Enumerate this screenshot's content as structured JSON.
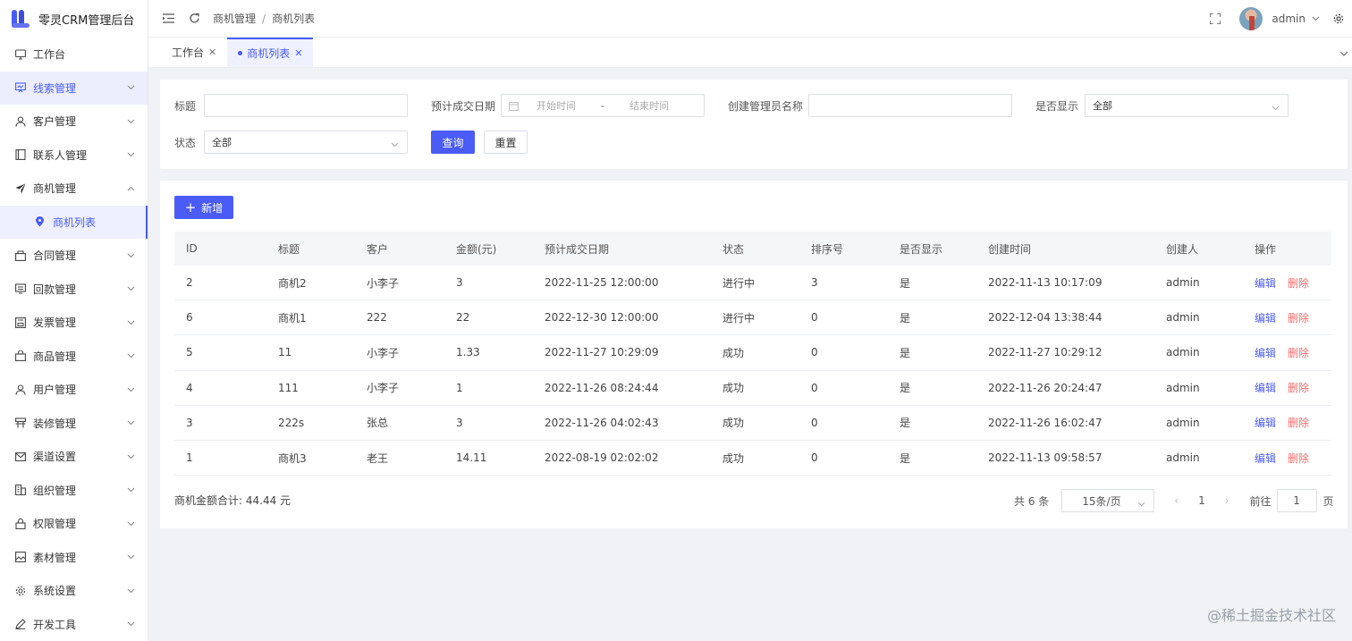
{
  "app": {
    "title": "零灵CRM管理后台"
  },
  "sidebar": {
    "items": [
      {
        "label": "工作台",
        "icon": "monitor-icon"
      },
      {
        "label": "线索管理",
        "icon": "clue-icon"
      },
      {
        "label": "客户管理",
        "icon": "user-icon"
      },
      {
        "label": "联系人管理",
        "icon": "contacts-icon"
      },
      {
        "label": "商机管理",
        "icon": "send-icon"
      },
      {
        "label": "商机列表",
        "icon": "location-icon"
      },
      {
        "label": "合同管理",
        "icon": "contract-icon"
      },
      {
        "label": "回款管理",
        "icon": "payment-icon"
      },
      {
        "label": "发票管理",
        "icon": "invoice-icon"
      },
      {
        "label": "商品管理",
        "icon": "product-icon"
      },
      {
        "label": "用户管理",
        "icon": "user-icon"
      },
      {
        "label": "装修管理",
        "icon": "decor-icon"
      },
      {
        "label": "渠道设置",
        "icon": "mail-icon"
      },
      {
        "label": "组织管理",
        "icon": "org-icon"
      },
      {
        "label": "权限管理",
        "icon": "lock-icon"
      },
      {
        "label": "素材管理",
        "icon": "image-icon"
      },
      {
        "label": "系统设置",
        "icon": "gear-icon"
      },
      {
        "label": "开发工具",
        "icon": "pen-icon"
      }
    ]
  },
  "header": {
    "breadcrumb": [
      "商机管理",
      "商机列表"
    ],
    "user": "admin"
  },
  "tabs": [
    {
      "label": "工作台"
    },
    {
      "label": "商机列表"
    }
  ],
  "search": {
    "title_label": "标题",
    "date_label": "预计成交日期",
    "date_start_placeholder": "开始时间",
    "date_sep": "-",
    "date_end_placeholder": "结束时间",
    "creator_label": "创建管理员名称",
    "show_label": "是否显示",
    "show_value": "全部",
    "status_label": "状态",
    "status_value": "全部",
    "query_button": "查询",
    "reset_button": "重置"
  },
  "table": {
    "add_button": "新增",
    "columns": [
      "ID",
      "标题",
      "客户",
      "金额(元)",
      "预计成交日期",
      "状态",
      "排序号",
      "是否显示",
      "创建时间",
      "创建人",
      "操作"
    ],
    "rows": [
      [
        "2",
        "商机2",
        "小李子",
        "3",
        "2022-11-25 12:00:00",
        "进行中",
        "3",
        "是",
        "2022-11-13 10:17:09",
        "admin"
      ],
      [
        "6",
        "商机1",
        "222",
        "22",
        "2022-12-30 12:00:00",
        "进行中",
        "0",
        "是",
        "2022-12-04 13:38:44",
        "admin"
      ],
      [
        "5",
        "11",
        "小李子",
        "1.33",
        "2022-11-27 10:29:09",
        "成功",
        "0",
        "是",
        "2022-11-27 10:29:12",
        "admin"
      ],
      [
        "4",
        "111",
        "小李子",
        "1",
        "2022-11-26 08:24:44",
        "成功",
        "0",
        "是",
        "2022-11-26 20:24:47",
        "admin"
      ],
      [
        "3",
        "222s",
        "张总",
        "3",
        "2022-11-26 04:02:43",
        "成功",
        "0",
        "是",
        "2022-11-26 16:02:47",
        "admin"
      ],
      [
        "1",
        "商机3",
        "老王",
        "14.11",
        "2022-08-19 02:02:02",
        "成功",
        "0",
        "是",
        "2022-11-13 09:58:57",
        "admin"
      ]
    ],
    "edit_label": "编辑",
    "delete_label": "删除",
    "summary": "商机金额合计: 44.44 元"
  },
  "pagination": {
    "total": "共 6 条",
    "page_size": "15条/页",
    "current_page": "1",
    "goto_label": "前往",
    "goto_value": "1",
    "page_unit": "页"
  },
  "watermark": "@稀土掘金技术社区",
  "colors": {
    "primary": "#4a5cf5",
    "danger": "#f56c6c"
  }
}
